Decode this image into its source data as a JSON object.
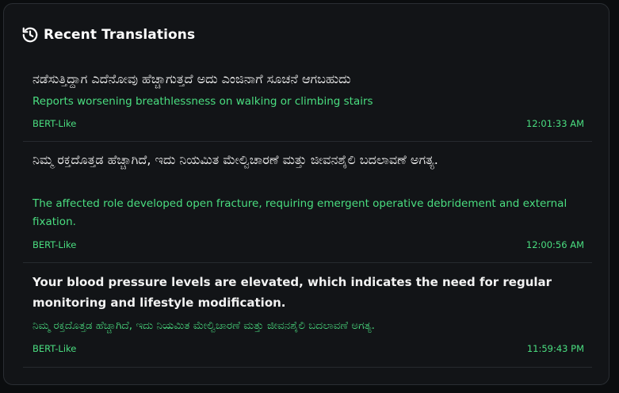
{
  "panel": {
    "title": "Recent Translations",
    "icon": "history-icon"
  },
  "entries": [
    {
      "source": "ನಡೆಸುತ್ತಿದ್ದಾಗ ಎದೆನೋವು ಹೆಚ್ಚಾಗುತ್ತದೆ ಅದು ಎಂಜಿನಾಗೆ ಸೂಚನೆ ಆಗಬಹುದು",
      "translation": "Reports worsening breathlessness on walking or climbing stairs",
      "model": "BERT-Like",
      "time": "12:01:33 AM"
    },
    {
      "source": "ನಿಮ್ಮ ರಕ್ತದೊತ್ತಡ ಹೆಚ್ಚಾಗಿದೆ, ಇದು ನಿಯಮಿತ ಮೇಲ್ವಿಚಾರಣೆ ಮತ್ತು ಜೀವನಶೈಲಿ ಬದಲಾವಣೆ ಅಗತ್ಯ.",
      "translation": "The affected role developed open fracture, requiring emergent operative debridement and external fixation.",
      "model": "BERT-Like",
      "time": "12:00:56 AM"
    },
    {
      "source": "Your blood pressure levels are elevated, which indicates the need for regular monitoring and lifestyle modification.",
      "translation": "ನಿಮ್ಮ ರಕ್ತದೊತ್ತಡ ಹೆಚ್ಚಾಗಿದೆ, ಇದು ನಿಯಮಿತ ಮೇಲ್ವಿಚಾರಣೆ ಮತ್ತು ಜೀವನಶೈಲಿ ಬದಲಾವಣೆ ಅಗತ್ಯ.",
      "model": "BERT-Like",
      "time": "11:59:43 PM"
    }
  ],
  "colors": {
    "background": "#121417",
    "accent": "#4ade80",
    "text": "#f2f2f2"
  }
}
